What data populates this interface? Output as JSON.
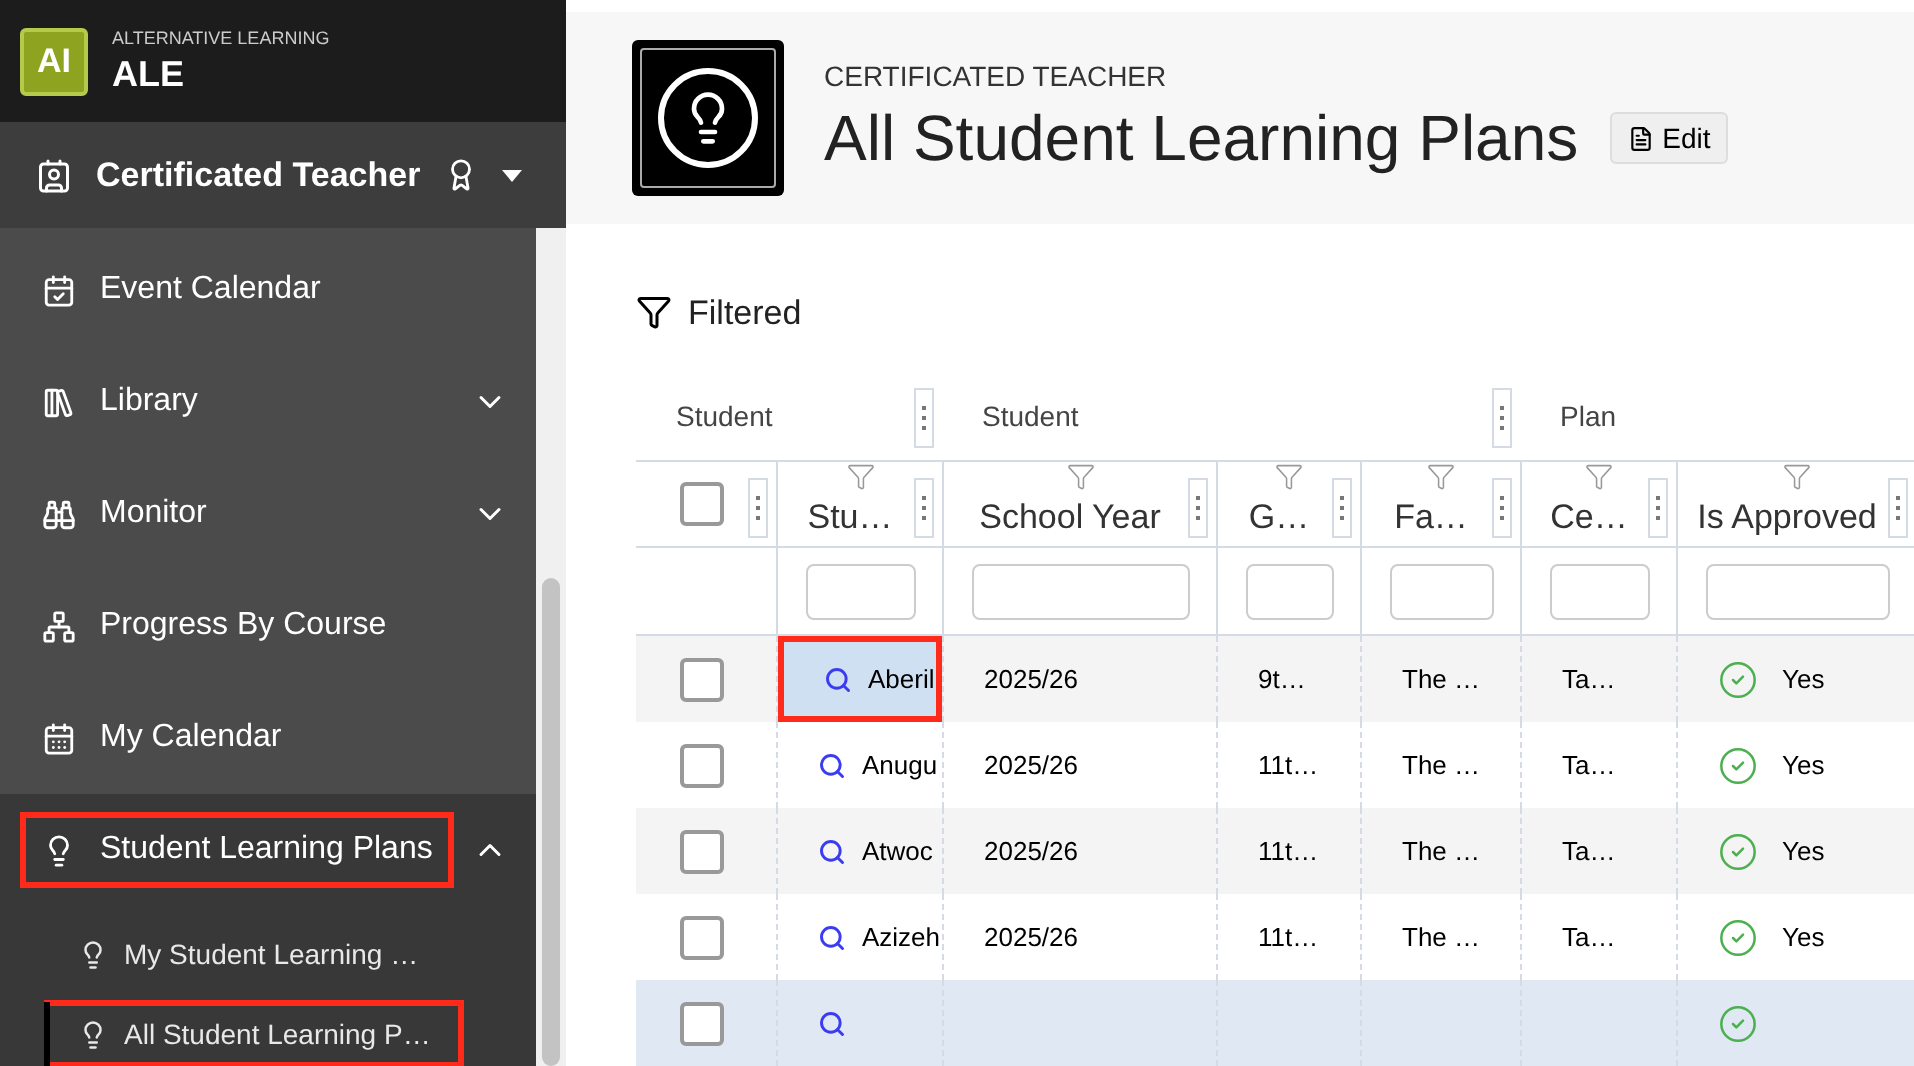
{
  "app": {
    "logo": "AI",
    "subtitle": "ALTERNATIVE LEARNING",
    "name": "ALE"
  },
  "role_switcher": {
    "label": "Certificated Teacher"
  },
  "sidebar": {
    "items": [
      {
        "kind": "calendar",
        "label": "Event Calendar"
      },
      {
        "kind": "library",
        "label": "Library",
        "expanded": false
      },
      {
        "kind": "binoculars",
        "label": "Monitor",
        "expanded": false
      },
      {
        "kind": "progress",
        "label": "Progress By Course"
      },
      {
        "kind": "grid",
        "label": "My Calendar"
      },
      {
        "kind": "bulb",
        "label": "Student Learning Plans",
        "expanded": true,
        "highlighted": true,
        "children": [
          {
            "label": "My Student Learning …",
            "selected": false,
            "highlighted": false
          },
          {
            "label": "All Student Learning P…",
            "selected": true,
            "highlighted": true
          }
        ]
      }
    ]
  },
  "page": {
    "overline": "CERTIFICATED TEACHER",
    "title": "All Student Learning Plans",
    "edit_button": "Edit"
  },
  "filter_label": "Filtered",
  "table": {
    "groups": [
      {
        "label": "Student"
      },
      {
        "label": "Student"
      },
      {
        "label": "Plan"
      }
    ],
    "select_all_checked": false,
    "columns": [
      "Stu…",
      "School Year",
      "G…",
      "Fa…",
      "Ce…",
      "Is Approved"
    ],
    "rows": [
      {
        "selected": false,
        "checked": false,
        "cells": [
          "Aberil",
          "2025/26",
          "9t…",
          "The …",
          "Ta…",
          "Yes"
        ],
        "approved": true,
        "focused_cell": true
      },
      {
        "selected": false,
        "checked": false,
        "cells": [
          "Anugu",
          "2025/26",
          "11t…",
          "The …",
          "Ta…",
          "Yes"
        ],
        "approved": true,
        "focused_cell": false
      },
      {
        "selected": false,
        "checked": false,
        "cells": [
          "Atwoc",
          "2025/26",
          "11t…",
          "The …",
          "Ta…",
          "Yes"
        ],
        "approved": true,
        "focused_cell": false
      },
      {
        "selected": false,
        "checked": false,
        "cells": [
          "Azizeh",
          "2025/26",
          "11t…",
          "The …",
          "Ta…",
          "Yes"
        ],
        "approved": true,
        "focused_cell": false
      },
      {
        "selected": true,
        "checked": false,
        "cells": [],
        "approved": true,
        "focused_cell": false
      }
    ]
  }
}
